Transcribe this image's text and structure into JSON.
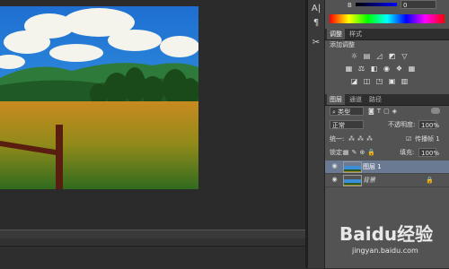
{
  "color_panel": {
    "b_label": "B",
    "b_value": "0"
  },
  "adjustments": {
    "tabs": [
      "调整",
      "样式"
    ],
    "add_label": "添加调整",
    "row1": [
      "sun-icon",
      "levels-icon",
      "curves-icon",
      "exposure-icon",
      "triangle-down-icon"
    ],
    "row2": [
      "vibrance-icon",
      "balance-icon",
      "color-balance-icon",
      "bw-icon",
      "photo-filter-icon",
      "channel-mixer-icon",
      "lookup-icon"
    ],
    "row3": [
      "invert-icon",
      "posterize-icon",
      "threshold-icon",
      "selective-color-icon",
      "gradient-map-icon"
    ]
  },
  "layers": {
    "tabs": [
      "图层",
      "通道",
      "路径"
    ],
    "filter_label": "类型",
    "blend_mode": "正常",
    "opacity_label": "不透明度:",
    "opacity_value": "100%",
    "unify_label": "统一:",
    "propagate_label": "传播帧 1",
    "lock_label": "锁定:",
    "fill_label": "填充:",
    "fill_value": "100%",
    "items": [
      {
        "name": "图层 1",
        "selected": true
      },
      {
        "name": "背景",
        "selected": false
      }
    ]
  },
  "watermark": {
    "brand": "Baidu经验",
    "url": "jingyan.baidu.com"
  },
  "colors": {
    "panel": "#535353",
    "selected_layer": "#6b7a93",
    "canvas_bg": "#2b2b2b"
  }
}
